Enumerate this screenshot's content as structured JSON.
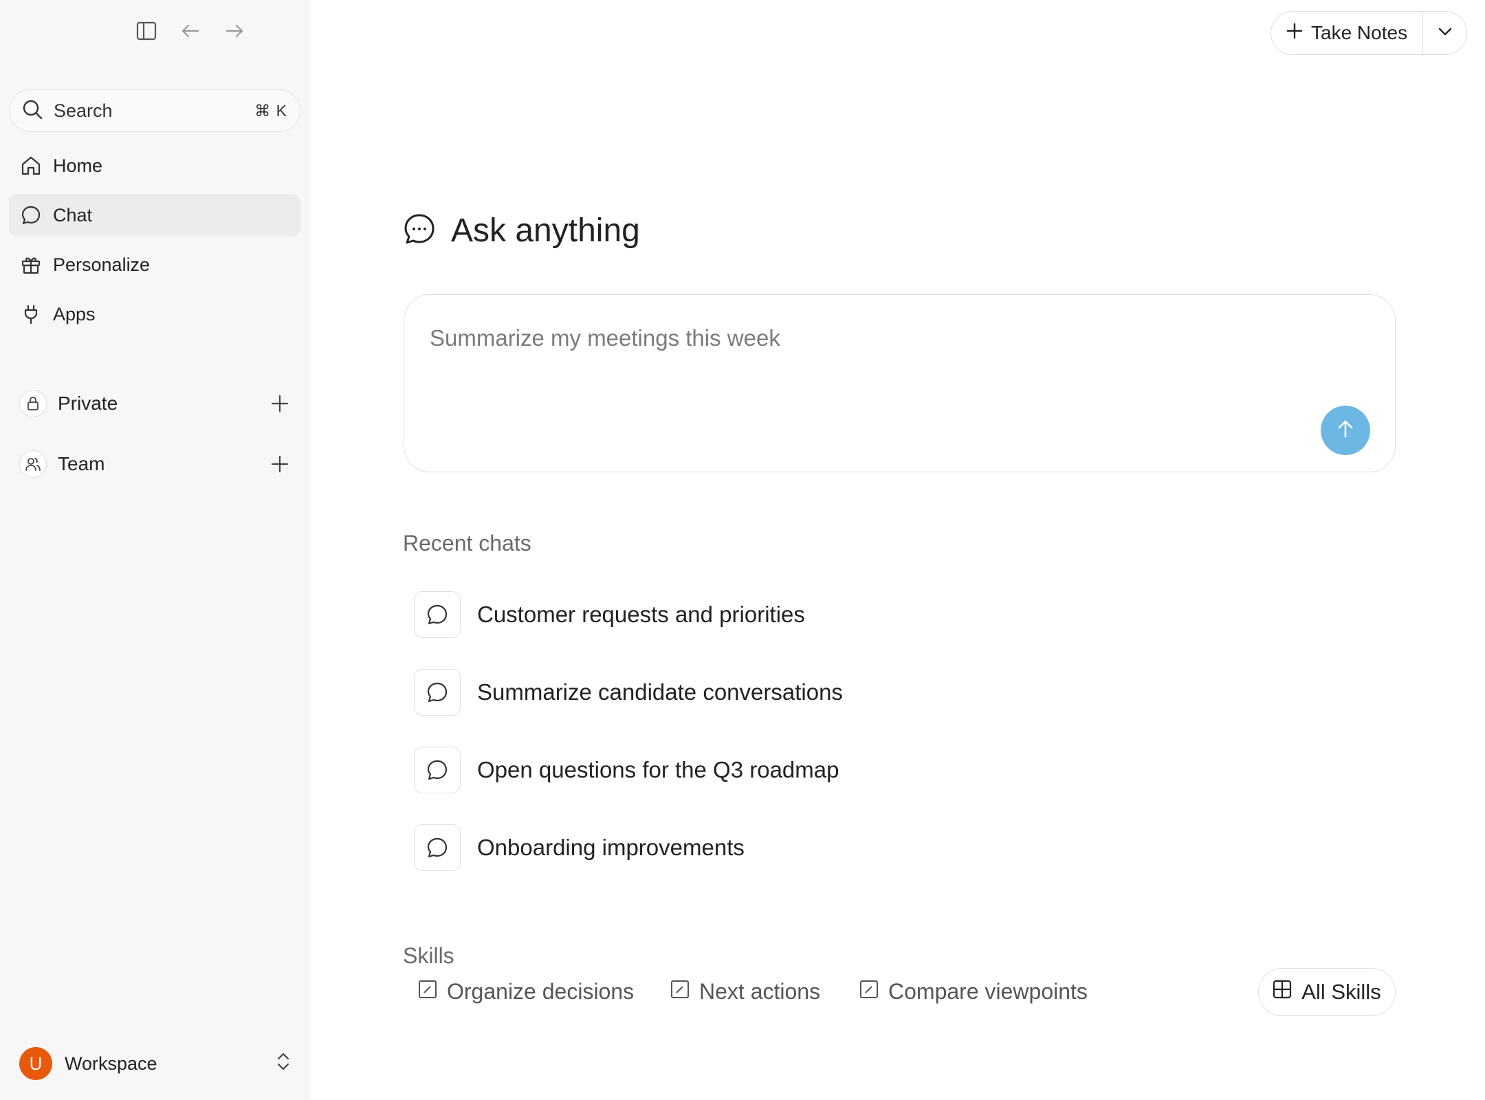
{
  "sidebar": {
    "search": {
      "label": "Search",
      "shortcut": "⌘ K"
    },
    "nav": [
      {
        "label": "Home",
        "icon": "home-icon"
      },
      {
        "label": "Chat",
        "icon": "chat-icon",
        "active": true
      },
      {
        "label": "Personalize",
        "icon": "gift-icon"
      },
      {
        "label": "Apps",
        "icon": "plug-icon"
      }
    ],
    "sections": [
      {
        "label": "Private",
        "icon": "lock-icon"
      },
      {
        "label": "Team",
        "icon": "users-icon"
      }
    ],
    "workspace": {
      "avatar_letter": "U",
      "label": "Workspace",
      "avatar_color": "#e8590c"
    }
  },
  "header": {
    "take_notes_label": "Take Notes"
  },
  "main": {
    "title": "Ask anything",
    "composer": {
      "placeholder": "Summarize my meetings this week",
      "send_color": "#6db7e3"
    },
    "recent_label": "Recent chats",
    "recent_chats": [
      "Customer requests and priorities",
      "Summarize candidate conversations",
      "Open questions for the Q3 roadmap",
      "Onboarding improvements"
    ],
    "skills_label": "Skills",
    "skills": [
      "Organize decisions",
      "Next actions",
      "Compare viewpoints"
    ],
    "all_skills_label": "All Skills"
  }
}
